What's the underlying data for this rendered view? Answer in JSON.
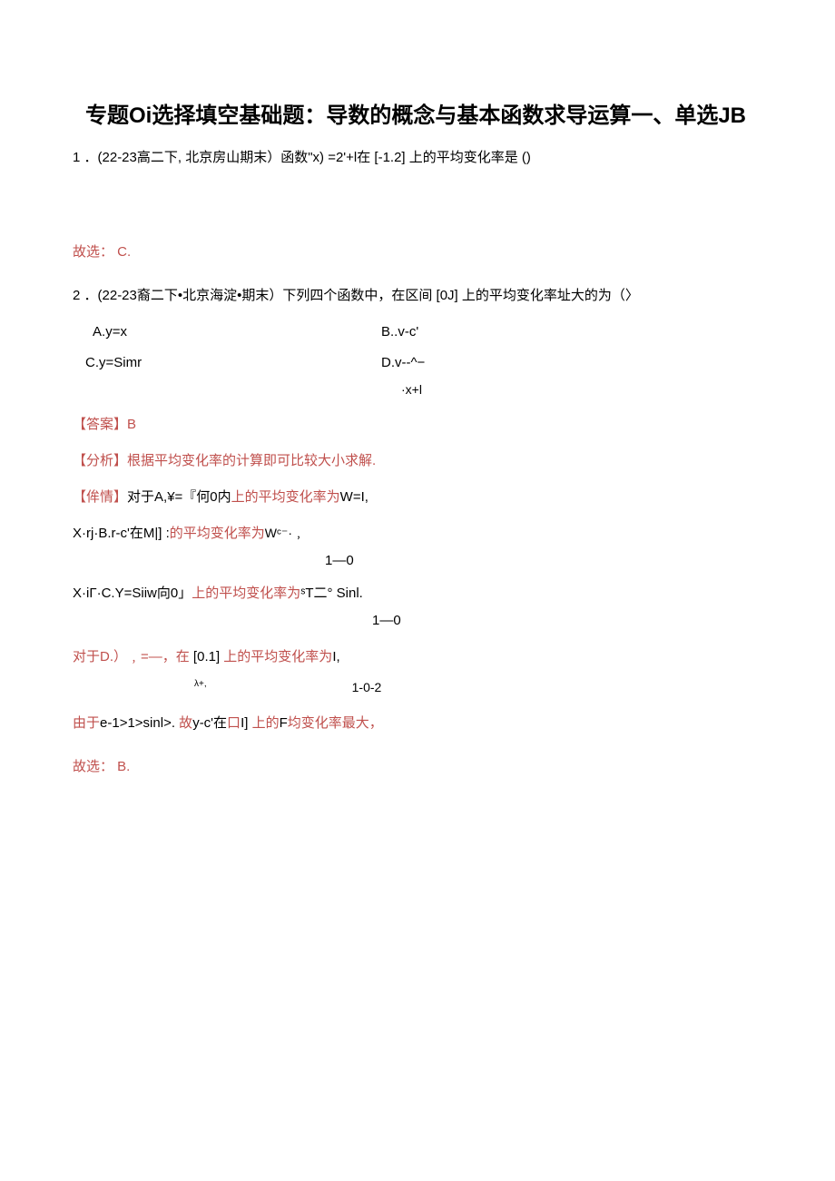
{
  "title": "专题Oi选择填空基础题：导数的概念与基本函数求导运算一、单选JB",
  "q1": {
    "text": "1 ．(22-23高二下, 北京房山期末）函数\"x)  =2'+l在  [-1.2]  上的平均变化率是  ()",
    "conclusion": "故选： C."
  },
  "q2": {
    "text": "2 ．(22-23裔二下•北京海淀•期末）下列四个函数中，在区间  [0J]  上的平均变化率址大的为（〉",
    "optA": "A.y=x",
    "optB": "B..v-c'",
    "optC": "C.y=Simr",
    "optD": "D.v--^−",
    "optD_sub": "·x+l",
    "answer": "【答案】B",
    "analysis_label": "【分析】",
    "analysis_text": "根据平均变化率的计算即可比较大小求解.",
    "detail_label": "【侔情】",
    "detail_a_black1": "对于A,¥=『何0内",
    "detail_a_red": "上的平均变化率为",
    "detail_a_black2": "W=I,",
    "detail_b_black1": "X·rj·B.r-c'在M|]  :",
    "detail_b_red": "的平均变化率为",
    "detail_b_black2": "Wᶜ⁻·﹐",
    "detail_b_under": "1—0",
    "detail_c_black1": "X·iΓ·C.Y=Siiw向0」",
    "detail_c_red": "上的平均变化率为",
    "detail_c_black2": "ˢT二° Sinl.",
    "detail_c_under": "1—0",
    "detail_d_red1": "对于D.）﹐=—，在",
    "detail_d_black1": "  [0.1]  ",
    "detail_d_red2": "上的平均变化率为",
    "detail_d_black2": "I,",
    "detail_d_sub": "λ+,",
    "detail_d_under": "1-0-2",
    "conclusion_line_red1": "由于",
    "conclusion_line_black1": "e-1>1>sinl>. ",
    "conclusion_line_red2": "故",
    "conclusion_line_black2": "y-c'在",
    "conclusion_line_red3": "口",
    "conclusion_line_black3": "I]  ",
    "conclusion_line_red4": "上的",
    "conclusion_line_black4": "F",
    "conclusion_line_red5": "均变化率最大，",
    "final": "故选： B."
  }
}
